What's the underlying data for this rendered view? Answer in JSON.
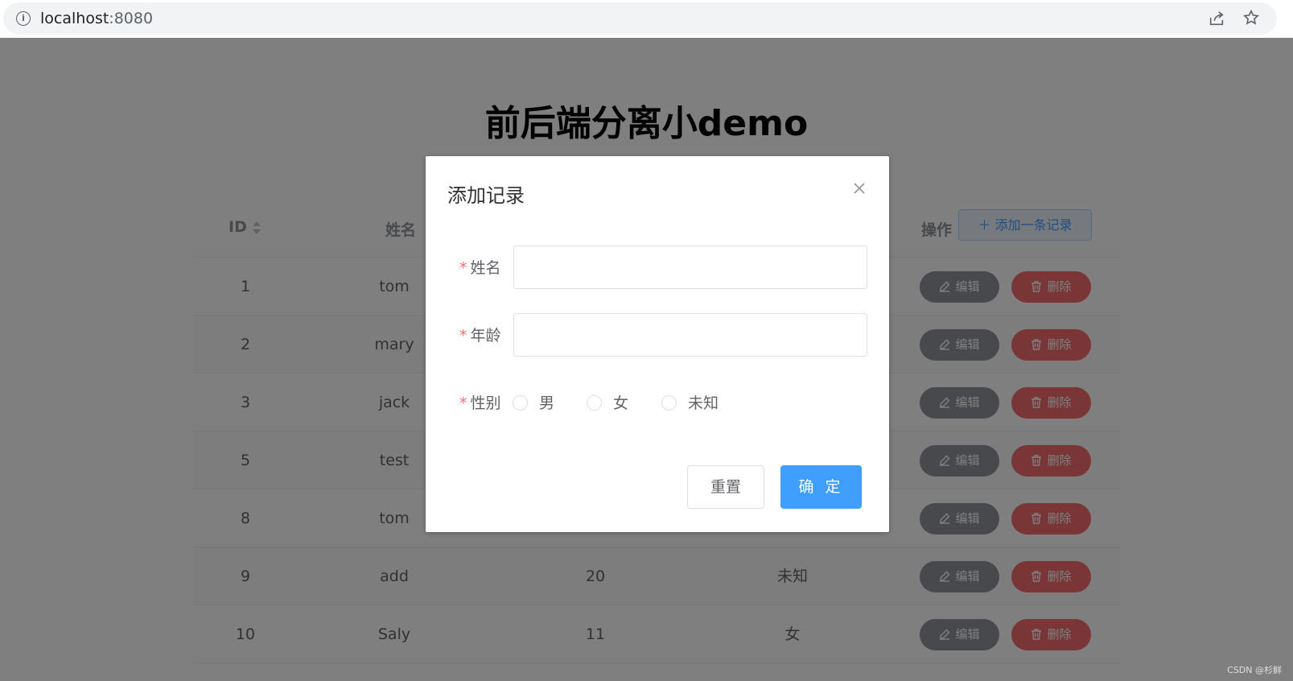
{
  "browser": {
    "host": "localhost",
    "port": ":8080",
    "info_icon": "i"
  },
  "page": {
    "title": "前后端分离小demo"
  },
  "table": {
    "headers": {
      "id": "ID",
      "name": "姓名",
      "actions": "操作"
    },
    "add_button": "添加一条记录",
    "edit_label": "编辑",
    "delete_label": "删除",
    "rows": [
      {
        "id": "1",
        "name": "tom",
        "age": "",
        "gender": ""
      },
      {
        "id": "2",
        "name": "mary",
        "age": "",
        "gender": ""
      },
      {
        "id": "3",
        "name": "jack",
        "age": "",
        "gender": ""
      },
      {
        "id": "5",
        "name": "test",
        "age": "",
        "gender": ""
      },
      {
        "id": "8",
        "name": "tom",
        "age": "",
        "gender": ""
      },
      {
        "id": "9",
        "name": "add",
        "age": "20",
        "gender": "未知"
      },
      {
        "id": "10",
        "name": "Saly",
        "age": "11",
        "gender": "女"
      }
    ]
  },
  "dialog": {
    "title": "添加记录",
    "required_mark": "*",
    "name_label": "姓名",
    "name_value": "",
    "age_label": "年龄",
    "age_value": "",
    "gender_label": "性别",
    "gender_options": [
      "男",
      "女",
      "未知"
    ],
    "reset_label": "重置",
    "confirm_label": "确 定"
  },
  "watermark": "CSDN @杉鲜",
  "colors": {
    "primary": "#409eff",
    "danger": "#f56c6c",
    "info": "#909399"
  }
}
